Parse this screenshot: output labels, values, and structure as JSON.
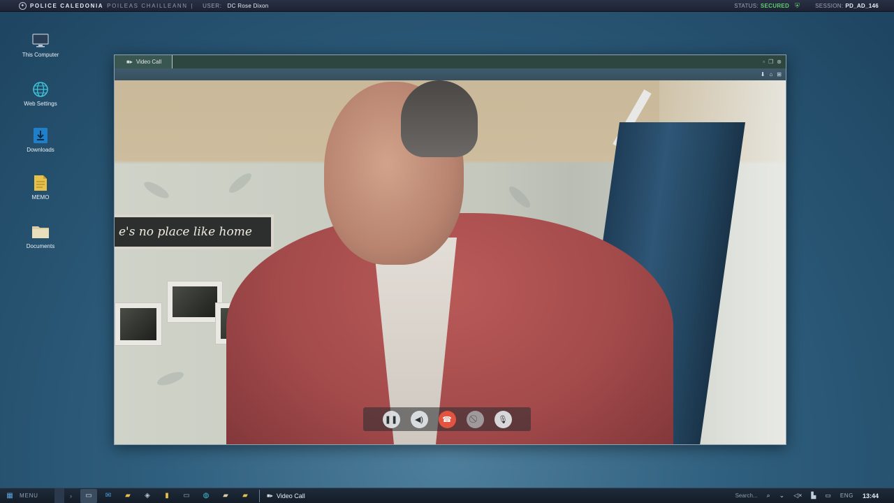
{
  "topbar": {
    "org": "POLICE CALEDONIA",
    "org_gaelic": "POILEAS CHAILLEANN",
    "separator": "|",
    "user_label": "USER:",
    "user_name": "DC Rose Dixon",
    "status_label": "STATUS:",
    "status_value": "SECURED",
    "session_label": "SESSION:",
    "session_value": "PD_AD_146"
  },
  "desktop_icons": [
    {
      "label": "This Computer",
      "icon": "monitor-icon"
    },
    {
      "label": "Web Settings",
      "icon": "globe-icon"
    },
    {
      "label": "Downloads",
      "icon": "download-icon"
    },
    {
      "label": "MEMO",
      "icon": "memo-icon"
    },
    {
      "label": "Documents",
      "icon": "folder-icon"
    }
  ],
  "window": {
    "tab_title": "Video Call",
    "sign_text": "e's no place like home",
    "controls": [
      "pause",
      "volume",
      "hang-up",
      "video-off",
      "microphone"
    ]
  },
  "taskbar": {
    "menu_label": "MENU",
    "active_window": "Video Call",
    "search_placeholder": "Search...",
    "language": "ENG",
    "clock": "13:44"
  },
  "colors": {
    "status_secured": "#5fd16a",
    "hangup": "#e2543f",
    "window_tabbar": "#2e4640"
  }
}
